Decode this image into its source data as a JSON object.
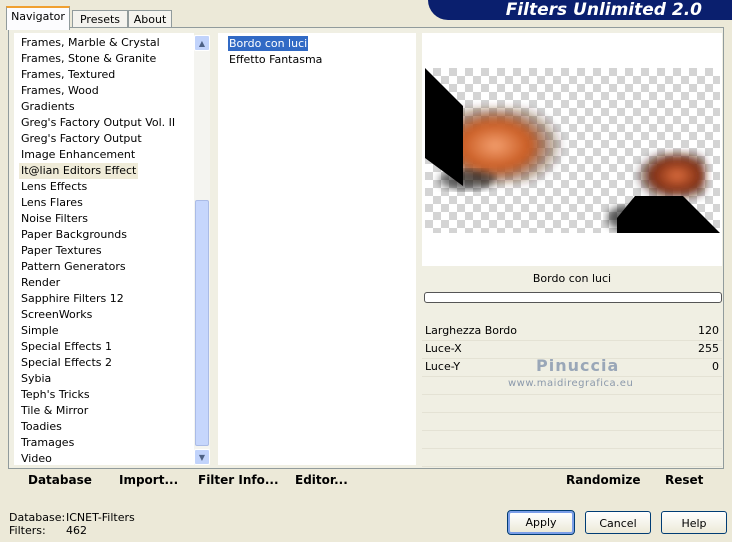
{
  "tabs": [
    "Navigator",
    "Presets",
    "About"
  ],
  "app_title": "Filters Unlimited 2.0",
  "categories": [
    "Frames, Marble & Crystal",
    "Frames, Stone & Granite",
    "Frames, Textured",
    "Frames, Wood",
    "Gradients",
    "Greg's Factory Output Vol. II",
    "Greg's Factory Output",
    "Image Enhancement",
    "It@lian Editors Effect",
    "Lens Effects",
    "Lens Flares",
    "Noise Filters",
    "Paper Backgrounds",
    "Paper Textures",
    "Pattern Generators",
    "Render",
    "Sapphire Filters 12",
    "ScreenWorks",
    "Simple",
    "Special Effects 1",
    "Special Effects 2",
    "Sybia",
    "Teph's Tricks",
    "Tile & Mirror",
    "Toadies",
    "Tramages",
    "Video"
  ],
  "filters": [
    "Bordo con luci",
    "Effetto Fantasma"
  ],
  "filter_name": "Bordo con luci",
  "params": [
    {
      "label": "Larghezza Bordo",
      "value": "120"
    },
    {
      "label": "Luce-X",
      "value": "255"
    },
    {
      "label": "Luce-Y",
      "value": "0"
    }
  ],
  "watermark": {
    "name": "Pinuccia",
    "url": "www.maidiregrafica.eu"
  },
  "bottom_buttons": [
    "Database",
    "Import...",
    "Filter Info...",
    "Editor..."
  ],
  "right_buttons": [
    "Randomize",
    "Reset"
  ],
  "info": {
    "database_label": "Database:",
    "database_value": "ICNET-Filters",
    "filters_label": "Filters:",
    "filters_value": "462"
  },
  "dialog_buttons": [
    "Apply",
    "Cancel",
    "Help"
  ]
}
